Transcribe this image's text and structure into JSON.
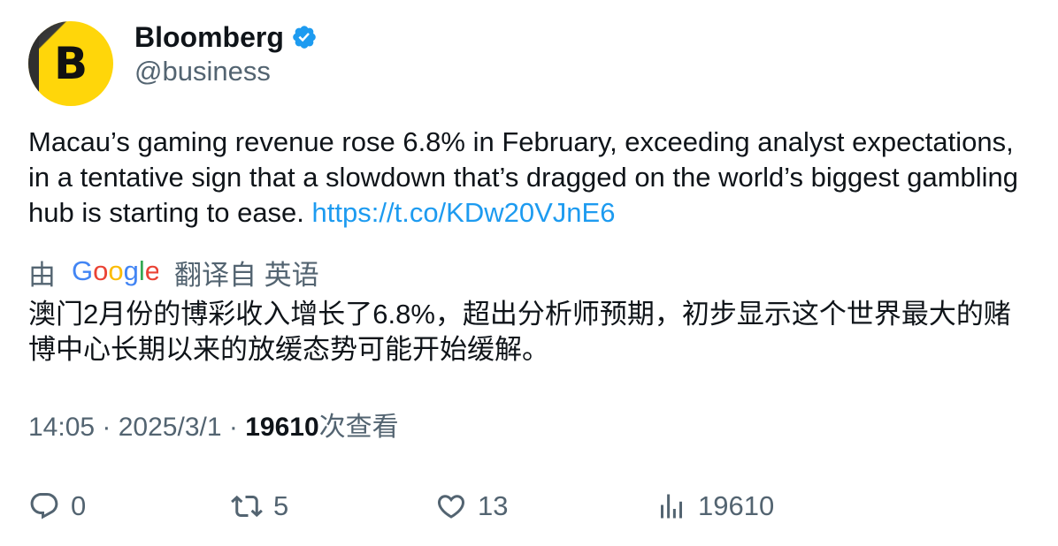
{
  "author": {
    "display_name": "Bloomberg",
    "handle": "@business",
    "avatar_letter": "B",
    "verified": true
  },
  "tweet": {
    "text": "Macau’s gaming revenue rose 6.8% in February, exceeding analyst expectations, in a tentative sign that a slowdown that’s dragged on the world’s biggest gambling hub is starting to ease.",
    "link": "https://t.co/KDw20VJnE6"
  },
  "translation": {
    "prefix": "由",
    "provider": "Google",
    "label": "翻译自 英语",
    "text": "澳门2月份的博彩收入增长了6.8%，超出分析师预期，初步显示这个世界最大的赌博中心长期以来的放缓态势可能开始缓解。"
  },
  "meta": {
    "time": "14:05",
    "separator": " · ",
    "date": "2025/3/1",
    "views": "19610",
    "views_label": "次查看"
  },
  "actions": {
    "replies": "0",
    "retweets": "5",
    "likes": "13",
    "views": "19610"
  },
  "colors": {
    "text_primary": "#0f1419",
    "text_secondary": "#536471",
    "link": "#1d9bf0",
    "verified": "#1d9bf0",
    "avatar_bg": "#ffd60a"
  }
}
